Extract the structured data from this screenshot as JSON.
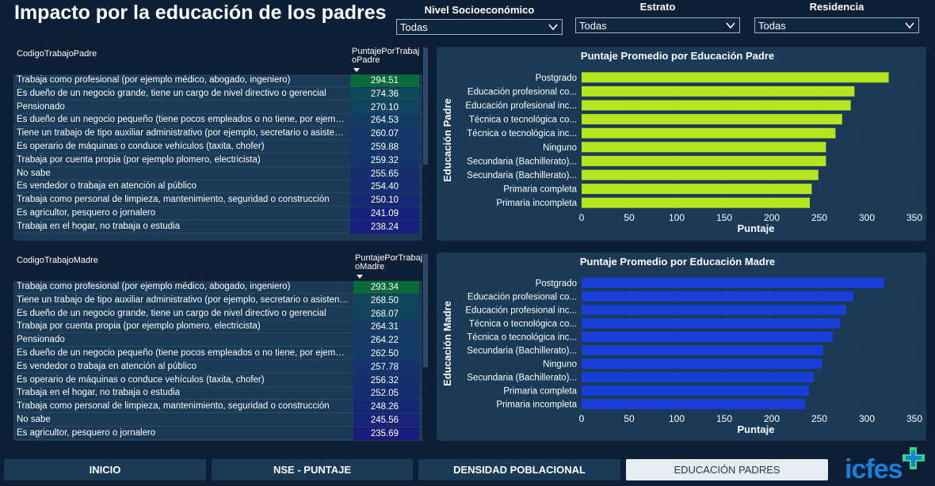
{
  "page": {
    "title": "Impacto por la educación de los padres"
  },
  "filters": [
    {
      "label": "Nivel Socioeconómico",
      "value": "Todas"
    },
    {
      "label": "Estrato",
      "value": "Todas"
    },
    {
      "label": "Residencia",
      "value": "Todas"
    }
  ],
  "father_table": {
    "col1": "CodigoTrabajoPadre",
    "col2": "PuntajePorTrabajoPadre",
    "rows": [
      {
        "label": "Trabaja como profesional (por ejemplo médico, abogado, ingeniero)",
        "value": "294.51",
        "color": "#0a6b3a"
      },
      {
        "label": "Es dueño de un negocio grande, tiene un cargo de nivel directivo o gerencial",
        "value": "274.36",
        "color": "#0e4a5c"
      },
      {
        "label": "Pensionado",
        "value": "270.10",
        "color": "#104461"
      },
      {
        "label": "Es dueño de un negocio pequeño (tiene pocos empleados o no tiene, por ejemplo tienda, papelería, etc)",
        "value": "264.53",
        "color": "#123c66"
      },
      {
        "label": "Tiene un trabajo de tipo auxiliar administrativo (por ejemplo, secretario o asistente)",
        "value": "260.07",
        "color": "#13366b"
      },
      {
        "label": "Es operario de máquinas o conduce vehículos (taxita, chofer)",
        "value": "259.88",
        "color": "#13366b"
      },
      {
        "label": "Trabaja por cuenta propia (por ejemplo plomero, electricista)",
        "value": "259.32",
        "color": "#14356c"
      },
      {
        "label": "No sabe",
        "value": "255.65",
        "color": "#152f70"
      },
      {
        "label": "Es vendedor o trabaja en atención al público",
        "value": "254.40",
        "color": "#152e71"
      },
      {
        "label": "Trabaja como personal de limpieza, mantenimiento, seguridad o construcción",
        "value": "250.10",
        "color": "#162a75"
      },
      {
        "label": "Es agricultor, pesquero o jornalero",
        "value": "241.09",
        "color": "#18217c"
      },
      {
        "label": "Trabaja en el hogar, no trabaja o estudia",
        "value": "238.24",
        "color": "#191e7f"
      }
    ]
  },
  "mother_table": {
    "col1": "CodigoTrabajoMadre",
    "col2": "PuntajePorTrabajoMadre",
    "rows": [
      {
        "label": "Trabaja como profesional (por ejemplo médico, abogado, ingeniero)",
        "value": "293.34",
        "color": "#0a6b3a"
      },
      {
        "label": "Tiene un trabajo de tipo auxiliar administrativo (por ejemplo, secretario o asistente)",
        "value": "268.50",
        "color": "#10445f"
      },
      {
        "label": "Es dueño de un negocio grande, tiene un cargo de nivel directivo o gerencial",
        "value": "268.07",
        "color": "#10445f"
      },
      {
        "label": "Trabaja por cuenta propia (por ejemplo plomero, electricista)",
        "value": "264.31",
        "color": "#123c66"
      },
      {
        "label": "Pensionado",
        "value": "264.22",
        "color": "#123c66"
      },
      {
        "label": "Es dueño de un negocio pequeño (tiene pocos empleados o no tiene, por ejemplo tienda, papelería, etc)",
        "value": "262.50",
        "color": "#133a68"
      },
      {
        "label": "Es vendedor o trabaja en atención al público",
        "value": "257.78",
        "color": "#14336d"
      },
      {
        "label": "Es operario de máquinas o conduce vehículos (taxita, chofer)",
        "value": "256.32",
        "color": "#15306f"
      },
      {
        "label": "Trabaja en el hogar, no trabaja o estudia",
        "value": "252.05",
        "color": "#162c73"
      },
      {
        "label": "Trabaja como personal de limpieza, mantenimiento, seguridad o construcción",
        "value": "248.26",
        "color": "#172778"
      },
      {
        "label": "No sabe",
        "value": "245.56",
        "color": "#18247a"
      },
      {
        "label": "Es agricultor, pesquero o jornalero",
        "value": "235.69",
        "color": "#1a1c80"
      }
    ]
  },
  "chart_data": [
    {
      "type": "bar",
      "orientation": "horizontal",
      "title": "Puntaje Promedio por Educación Padre",
      "xlabel": "Puntaje",
      "ylabel": "Educación Padre",
      "categories": [
        "Postgrado",
        "Educación profesional co...",
        "Educación profesional inc...",
        "Técnica o tecnológica co...",
        "Técnica o tecnológica inc...",
        "Ninguno",
        "Secundaria (Bachillerato)...",
        "Secundaria (Bachillerato)...",
        "Primaria completa",
        "Primaria incompleta"
      ],
      "values": [
        323,
        287,
        283,
        274,
        267,
        257,
        257,
        249,
        242,
        240
      ],
      "xlim": [
        0,
        350
      ],
      "xticks": [
        0,
        50,
        100,
        150,
        200,
        250,
        300,
        350
      ],
      "color": "#b5e61d",
      "grid": true
    },
    {
      "type": "bar",
      "orientation": "horizontal",
      "title": "Puntaje Promedio por Educación Madre",
      "xlabel": "Puntaje",
      "ylabel": "Educación Madre",
      "categories": [
        "Postgrado",
        "Educación profesional co...",
        "Educación profesional inc...",
        "Técnica o tecnológica co...",
        "Técnica o tecnológica inc...",
        "Secundaria (Bachillerato)...",
        "Ninguno",
        "Secundaria (Bachillerato)...",
        "Primaria completa",
        "Primaria incompleta"
      ],
      "values": [
        318,
        286,
        278,
        272,
        264,
        254,
        253,
        244,
        239,
        235
      ],
      "xlim": [
        0,
        350
      ],
      "xticks": [
        0,
        50,
        100,
        150,
        200,
        250,
        300,
        350
      ],
      "color": "#1a3fd6",
      "grid": true
    }
  ],
  "nav": [
    {
      "label": "INICIO",
      "active": false
    },
    {
      "label": "NSE - PUNTAJE",
      "active": false
    },
    {
      "label": "DENSIDAD POBLACIONAL",
      "active": false
    },
    {
      "label": "EDUCACIÓN PADRES",
      "active": true
    }
  ],
  "logo": {
    "text": "icfes"
  }
}
